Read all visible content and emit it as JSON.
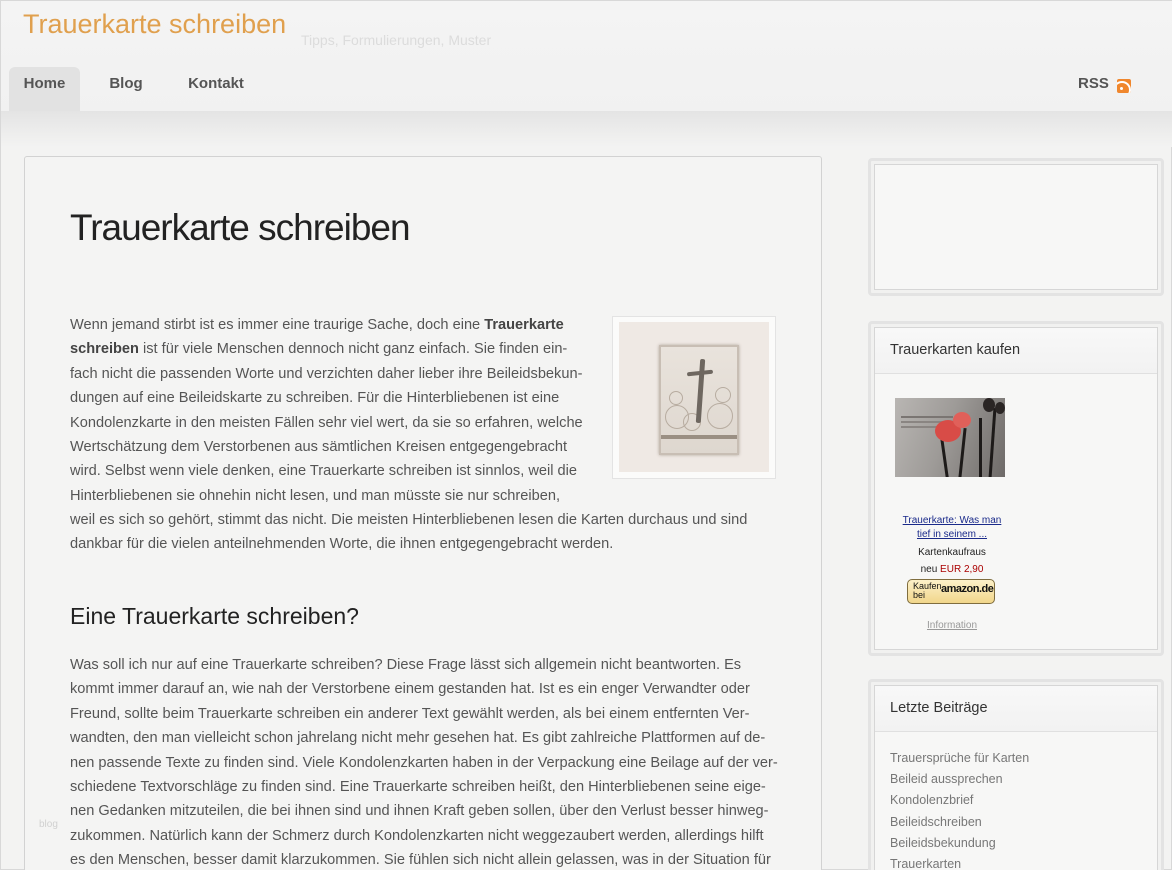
{
  "header": {
    "site_title": "Trauerkarte schreiben",
    "tagline": "Tipps, Formulierungen, Muster",
    "nav": [
      {
        "label": "Home",
        "active": true
      },
      {
        "label": "Blog",
        "active": false
      },
      {
        "label": "Kontakt",
        "active": false
      }
    ],
    "rss_label": "RSS",
    "rss_icon": "rss-feed-icon"
  },
  "post": {
    "title": "Trauerkarte schreiben",
    "intro_a": "Wenn jemand stirbt ist es immer eine traurige Sache, doch eine ",
    "intro_bold": "Trauerkarte schreiben",
    "intro_b": " ist für viele Menschen dennoch nicht ganz einfach. Sie finden ein-fach nicht die passenden Worte und verzichten daher lieber ihre Beileidsbekun-dungen auf eine Beileidskarte zu schreiben. Für die Hinterbliebenen ist eine Kondolenzkarte in den meisten Fällen sehr viel wert, da sie so erfahren, welche Wertschätzung dem Verstorbenen aus sämtlichen Kreisen entgegengebracht wird. Selbst wenn viele denken, eine Trauerkarte schreiben ist sinnlos, weil die Hinterbliebenen sie ohnehin nicht lesen, und man müsste sie nur schreiben,",
    "intro_c": "weil es sich so gehört, stimmt das nicht. Die meisten Hinterbliebenen lesen die Karten durchaus und sind dankbar für die vielen anteilnehmenden Worte, die ihnen entgegengebracht werden.",
    "subheading": "Eine Trauerkarte schreiben?",
    "body2": "Was soll ich nur auf eine Trauerkarte schreiben? Diese Frage lässt sich allgemein nicht beantworten. Es kommt immer darauf an, wie nah der Verstorbene einem gestanden hat. Ist es ein enger Verwandter oder Freund, sollte beim Trauerkarte schreiben ein anderer Text gewählt werden, als bei einem entfernten Ver-wandten, den man vielleicht schon jahrelang nicht mehr gesehen hat. Es gibt zahlreiche Plattformen auf de-nen passende Texte zu finden sind. Viele Kondolenzkarten haben in der Verpackung eine Beilage auf der ver-schiedene Textvorschläge zu finden sind. Eine Trauerkarte schreiben heißt, den Hinterbliebenen seine eige-nen Gedanken mitzuteilen, die bei ihnen sind und ihnen Kraft geben sollen, über den Verlust besser hinweg-zukommen. Natürlich kann der Schmerz durch Kondolenzkarten nicht weggezaubert werden, allerdings hilft es den Menschen, besser damit klarzukommen. Sie fühlen sich nicht allein gelassen, was in der Situation für",
    "footer_faint": "blog"
  },
  "sidebar": {
    "shop_title": "Trauerkarten kaufen",
    "product_link": "Trauerkarte: Was man tief in seinem ...",
    "seller": "Kartenkaufraus",
    "price_prefix": "neu ",
    "price": "EUR 2,90",
    "buy_small": "Kaufen bei",
    "buy_brand": "amazon.de",
    "info_link": "Information",
    "recent_title": "Letzte Beiträge",
    "recent": [
      "Trauersprüche für Karten",
      "Beileid aussprechen",
      "Kondolenzbrief",
      "Beileidschreiben",
      "Beileidsbekundung",
      "Trauerkarten"
    ]
  }
}
